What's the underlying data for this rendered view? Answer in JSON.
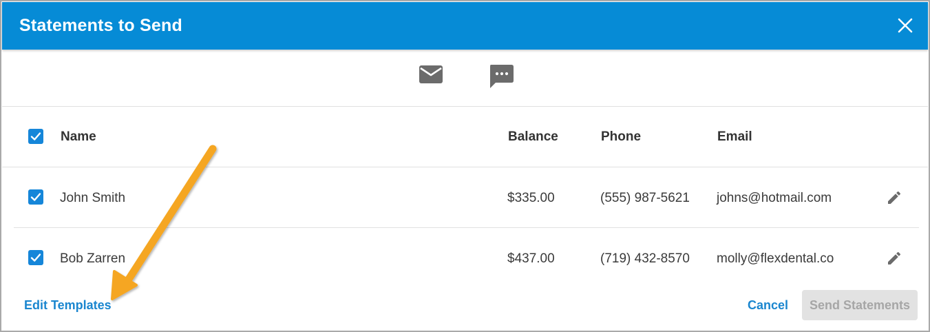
{
  "dialog": {
    "title": "Statements to Send",
    "close_icon": "close-icon"
  },
  "channels": [
    {
      "icon": "email-icon"
    },
    {
      "icon": "text-message-icon"
    }
  ],
  "table": {
    "columns": [
      "Name",
      "Balance",
      "Phone",
      "Email"
    ],
    "select_all_checked": true,
    "rows": [
      {
        "checked": true,
        "name": "John Smith",
        "balance": "$335.00",
        "phone": "(555) 987-5621",
        "email": "johns@hotmail.com"
      },
      {
        "checked": true,
        "name": "Bob Zarren",
        "balance": "$437.00",
        "phone": "(719) 432-8570",
        "email": "molly@flexdental.co"
      }
    ]
  },
  "footer": {
    "edit_templates_label": "Edit Templates",
    "cancel_label": "Cancel",
    "send_label": "Send Statements",
    "send_disabled": true
  },
  "annotation": {
    "arrow_color": "#f5a623",
    "target": "Edit Templates"
  },
  "colors": {
    "header_bg": "#068bd6",
    "accent": "#1586d9",
    "disabled_bg": "#e2e2e2"
  }
}
